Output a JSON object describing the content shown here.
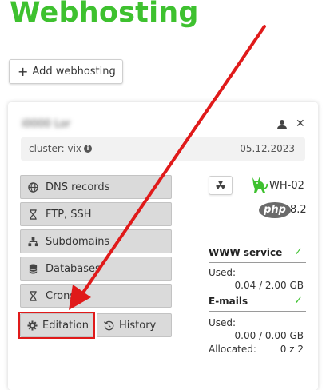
{
  "page": {
    "title": "Webhosting"
  },
  "toolbar": {
    "add_label": "Add webhosting"
  },
  "account": {
    "name": "i0000 Lor",
    "cluster_label": "cluster:",
    "cluster_value": "vix",
    "date": "05.12.2023"
  },
  "actions": {
    "dns": "DNS records",
    "ftp": "FTP, SSH",
    "subdomains": "Subdomains",
    "databases": "Databases",
    "crons": "Crons",
    "editation": "Editation",
    "history": "History"
  },
  "plan": {
    "name": "WH-02",
    "php_badge": "php",
    "php_version": "8.2"
  },
  "www": {
    "title": "WWW service",
    "used_label": "Used:",
    "used_value": "0.04 /  2.00 GB"
  },
  "emails": {
    "title": "E-mails",
    "used_label": "Used:",
    "used_value": "0.00 /  0.00 GB",
    "allocated_label": "Allocated:",
    "allocated_value": "0 z 2"
  },
  "colors": {
    "brand": "#3ec12f",
    "annotation": "#e01a1a"
  },
  "icons": {
    "user": "user-icon",
    "close": "close-icon",
    "info": "info-icon",
    "globe": "globe-icon",
    "hourglass": "hourglass-icon",
    "sitemap": "sitemap-icon",
    "database": "database-icon",
    "gear": "gear-icon",
    "history": "history-icon",
    "radiation": "radiation-icon",
    "cat": "cat-icon",
    "check": "check-icon"
  }
}
